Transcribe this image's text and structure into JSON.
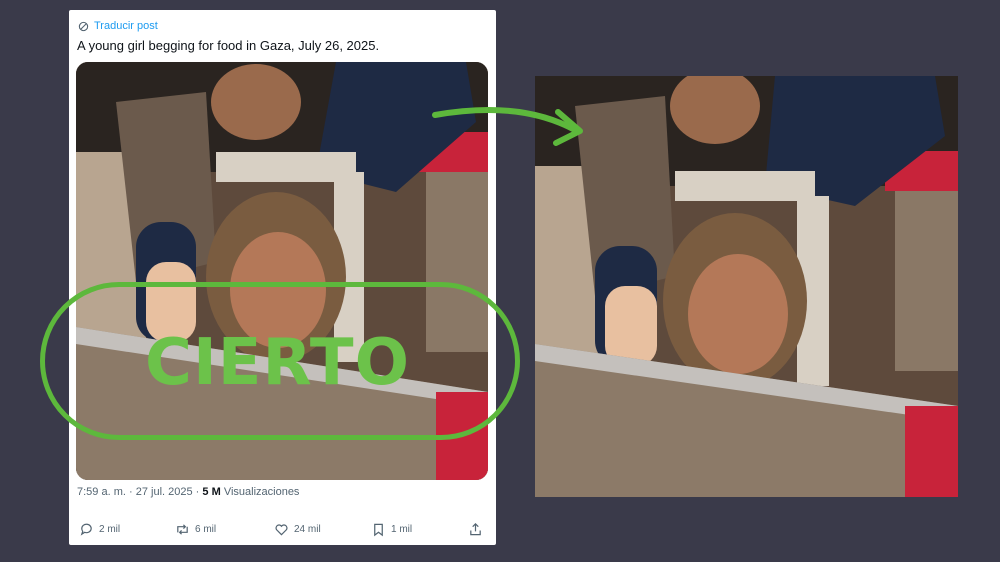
{
  "colors": {
    "background": "#3a3a4a",
    "accent": "#6cc24a",
    "link": "#1d9bf0"
  },
  "post": {
    "translate_label": "Traducir post",
    "text": "A young girl begging for food in Gaza, July 26, 2025.",
    "time": "7:59 a. m.",
    "date": "27 jul. 2025",
    "views_count": "5 M",
    "views_label": "Visualizaciones",
    "replies": "2 mil",
    "reposts": "6 mil",
    "likes": "24 mil",
    "bookmarks": "1 mil"
  },
  "verdict": {
    "label": "CIERTO"
  },
  "icons": [
    "translate-icon",
    "reply-icon",
    "repost-icon",
    "like-icon",
    "bookmark-icon",
    "share-icon",
    "arrow-icon"
  ]
}
